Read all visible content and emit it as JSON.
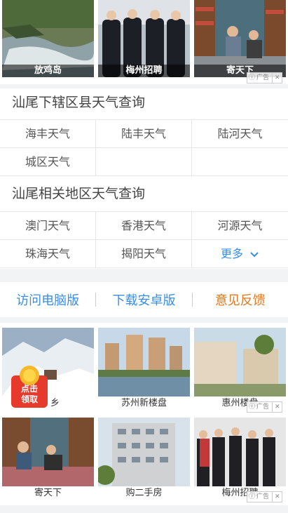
{
  "top_ads": [
    {
      "caption": "放鸡岛"
    },
    {
      "caption": "梅州招聘"
    },
    {
      "caption": "寄天下"
    }
  ],
  "ad_label": "广告",
  "county_section": {
    "title": "汕尾下辖区县天气查询",
    "items": [
      "海丰天气",
      "陆丰天气",
      "陆河天气",
      "城区天气",
      "",
      ""
    ]
  },
  "region_section": {
    "title": "汕尾相关地区天气查询",
    "items": [
      "澳门天气",
      "香港天气",
      "河源天气",
      "珠海天气",
      "揭阳天气",
      "更多"
    ]
  },
  "links": {
    "pc": "访问电脑版",
    "android": "下载安卓版",
    "feedback": "意见反馈",
    "colors": {
      "pc": "#3a8ee6",
      "android": "#3a8ee6",
      "feedback": "#e0781e"
    }
  },
  "bottom_ads": [
    {
      "caption": "乡"
    },
    {
      "caption": "苏州新楼盘"
    },
    {
      "caption": "惠州楼盘"
    },
    {
      "caption": "寄天下"
    },
    {
      "caption": "购二手房"
    },
    {
      "caption": "梅州招聘"
    }
  ],
  "redbag": {
    "line1": "点击",
    "line2": "领取"
  }
}
